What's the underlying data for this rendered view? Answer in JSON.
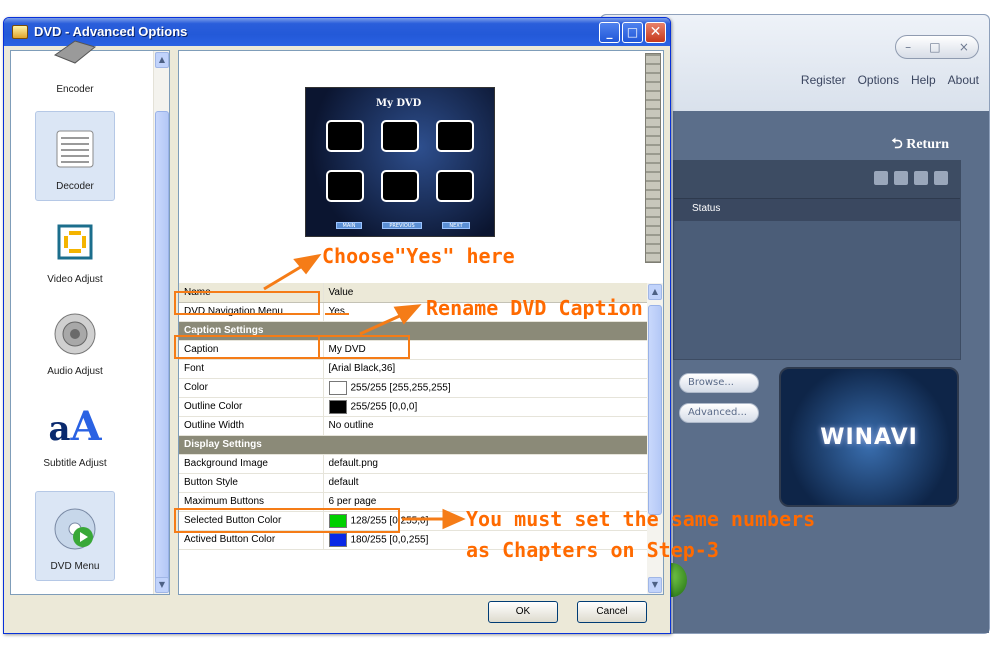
{
  "dialog": {
    "title": "DVD - Advanced Options",
    "ok_label": "OK",
    "cancel_label": "Cancel"
  },
  "sidebar": {
    "items": [
      {
        "label": "Encoder",
        "icon": "encoder-icon"
      },
      {
        "label": "Decoder",
        "icon": "decoder-icon"
      },
      {
        "label": "Video Adjust",
        "icon": "video-adjust-icon"
      },
      {
        "label": "Audio Adjust",
        "icon": "speaker-icon"
      },
      {
        "label": "Subtitle Adjust",
        "icon": "subtitle-icon"
      },
      {
        "label": "DVD Menu",
        "icon": "disc-icon"
      }
    ]
  },
  "preview": {
    "caption": "My DVD",
    "nav_buttons": [
      "MAIN",
      "PREVIOUS",
      "NEXT"
    ]
  },
  "table": {
    "headers": [
      "Name",
      "Value"
    ],
    "rows": [
      {
        "type": "row",
        "name": "DVD Navigation Menu",
        "value": "Yes"
      },
      {
        "type": "section",
        "name": "Caption Settings"
      },
      {
        "type": "row",
        "name": "Caption",
        "value": "My DVD"
      },
      {
        "type": "row",
        "name": "Font",
        "value": "[Arial Black,36]"
      },
      {
        "type": "row",
        "name": "Color",
        "value": "255/255 [255,255,255]",
        "swatch": "#ffffff"
      },
      {
        "type": "row",
        "name": "Outline Color",
        "value": "255/255 [0,0,0]",
        "swatch": "#000000"
      },
      {
        "type": "row",
        "name": "Outline Width",
        "value": "No outline"
      },
      {
        "type": "section",
        "name": "Display Settings"
      },
      {
        "type": "row",
        "name": "Background Image",
        "value": "default.png"
      },
      {
        "type": "row",
        "name": "Button Style",
        "value": "default"
      },
      {
        "type": "row",
        "name": "Maximum Buttons",
        "value": "6 per page"
      },
      {
        "type": "row",
        "name": "Selected Button Color",
        "value": "128/255 [0,255,0]",
        "swatch": "#00d000"
      },
      {
        "type": "row",
        "name": "Actived Button Color",
        "value": "180/255 [0,0,255]",
        "swatch": "#0a28e6"
      }
    ]
  },
  "annotations": {
    "choose_yes": "Choose\"Yes\" here",
    "rename_caption": "Rename DVD Caption",
    "same_numbers_line1": "You must set the same numbers",
    "same_numbers_line2": "as Chapters on Step-3",
    "color": "#ff6a00"
  },
  "background_app": {
    "menu": [
      "Register",
      "Options",
      "Help",
      "About"
    ],
    "return_label": "Return",
    "status_header": "Status",
    "browse_label": "Browse...",
    "advanced_label": "Advanced...",
    "logo_text": "WINAVI"
  }
}
